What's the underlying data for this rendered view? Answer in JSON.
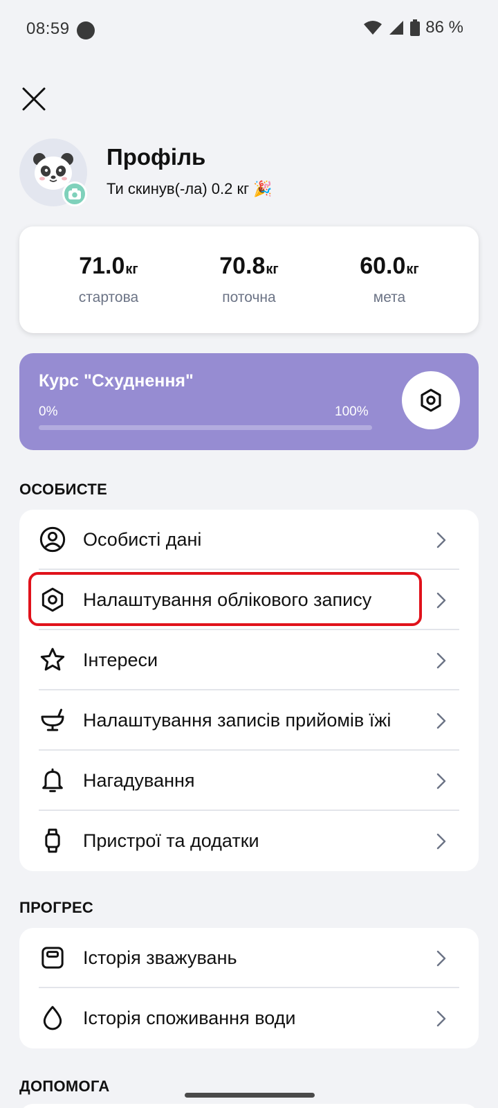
{
  "status_bar": {
    "time": "08:59",
    "battery": "86 %"
  },
  "profile": {
    "title": "Профіль",
    "subtitle": "Ти скинув(-ла) 0.2 кг 🎉"
  },
  "weights": [
    {
      "value": "71.0",
      "unit": "кг",
      "label": "стартова"
    },
    {
      "value": "70.8",
      "unit": "кг",
      "label": "поточна"
    },
    {
      "value": "60.0",
      "unit": "кг",
      "label": "мета"
    }
  ],
  "course": {
    "title": "Курс \"Схуднення\"",
    "start_label": "0%",
    "end_label": "100%",
    "progress": 0
  },
  "sections": {
    "personal": {
      "title": "ОСОБИСТЕ",
      "items": [
        {
          "label": "Особисті дані",
          "icon": "user-circle-icon"
        },
        {
          "label": "Налаштування облікового запису",
          "icon": "gear-icon"
        },
        {
          "label": "Інтереси",
          "icon": "star-icon"
        },
        {
          "label": "Налаштування записів прийомів їжі",
          "icon": "bowl-icon"
        },
        {
          "label": "Нагадування",
          "icon": "bell-icon"
        },
        {
          "label": "Пристрої та додатки",
          "icon": "watch-icon"
        }
      ]
    },
    "progress": {
      "title": "ПРОГРЕС",
      "items": [
        {
          "label": "Історія зважувань",
          "icon": "scale-icon"
        },
        {
          "label": "Історія споживання води",
          "icon": "water-drop-icon"
        }
      ]
    },
    "help": {
      "title": "ДОПОМОГА"
    }
  },
  "colors": {
    "background": "#f2f3f6",
    "course_card": "#968cd2",
    "highlight": "#e0121b",
    "badge": "#7fd1bb",
    "muted_text": "#6b7385"
  }
}
